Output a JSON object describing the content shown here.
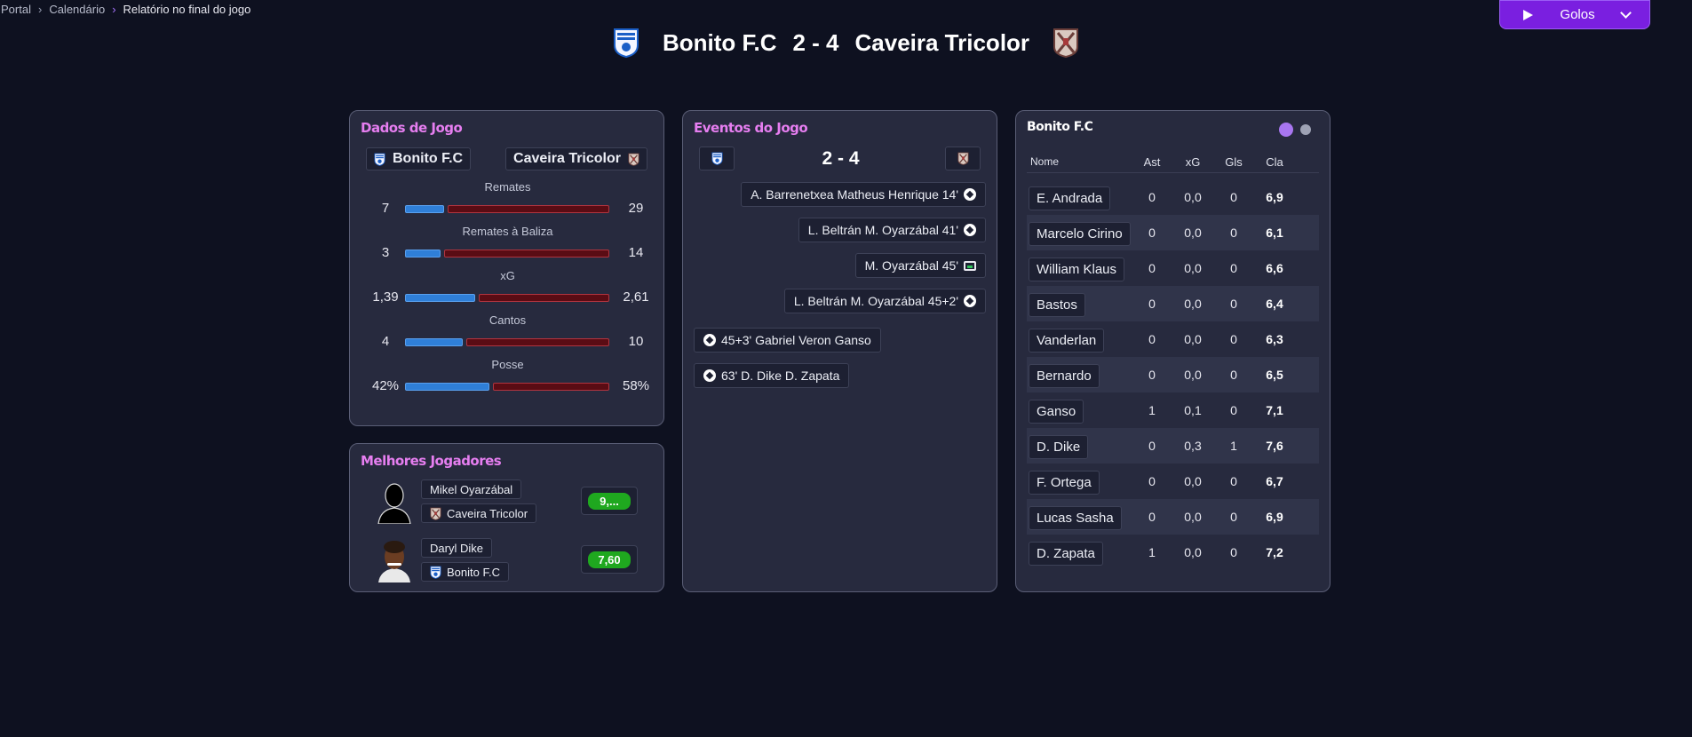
{
  "breadcrumb": [
    "Portal",
    "Calendário",
    "Relatório no final do jogo"
  ],
  "header": {
    "home_team": "Bonito F.C",
    "score": "2 - 4",
    "away_team": "Caveira Tricolor"
  },
  "play_button": {
    "label": "Golos",
    "icon": "play-icon"
  },
  "colors": {
    "accent": "#7a1fe0",
    "panel_title": "#e67ef0",
    "home_bar": "#2f7fd8",
    "away_bar": "#5a0c14",
    "rating": "#1fa81f"
  },
  "game_data": {
    "title": "Dados de Jogo",
    "home": "Bonito F.C",
    "away": "Caveira Tricolor",
    "stats": [
      {
        "label": "Remates",
        "home": "7",
        "away": "29",
        "home_frac": 0.194,
        "away_frac": 0.806
      },
      {
        "label": "Remates à Baliza",
        "home": "3",
        "away": "14",
        "home_frac": 0.176,
        "away_frac": 0.824
      },
      {
        "label": "xG",
        "home": "1,39",
        "away": "2,61",
        "home_frac": 0.348,
        "away_frac": 0.652
      },
      {
        "label": "Cantos",
        "home": "4",
        "away": "10",
        "home_frac": 0.286,
        "away_frac": 0.714
      },
      {
        "label": "Posse",
        "home": "42%",
        "away": "58%",
        "home_frac": 0.42,
        "away_frac": 0.58
      }
    ]
  },
  "best_players": {
    "title": "Melhores Jogadores",
    "players": [
      {
        "name": "Mikel Oyarzábal",
        "club": "Caveira Tricolor",
        "rating": "9,..."
      },
      {
        "name": "Daryl Dike",
        "club": "Bonito F.C",
        "rating": "7,60"
      }
    ]
  },
  "events": {
    "title": "Eventos do Jogo",
    "score": "2 - 4",
    "away": [
      {
        "text": "A. Barrenetxea  Matheus Henrique  14'",
        "icon": "ball-icon"
      },
      {
        "text": "L. Beltrán  M. Oyarzábal  41'",
        "icon": "ball-icon"
      },
      {
        "text": "M. Oyarzábal  45'",
        "icon": "var-icon"
      },
      {
        "text": "L. Beltrán  M. Oyarzábal  45+2'",
        "icon": "ball-icon"
      }
    ],
    "home": [
      {
        "text": "45+3'  Gabriel Veron  Ganso",
        "icon": "ball-icon"
      },
      {
        "text": "63'  D. Dike  D. Zapata",
        "icon": "ball-icon"
      }
    ]
  },
  "lineup": {
    "title": "Bonito F.C",
    "columns": [
      "Nome",
      "Ast",
      "xG",
      "Gls",
      "Cla"
    ],
    "rows": [
      {
        "name": "E. Andrada",
        "ast": "0",
        "xg": "0,0",
        "gls": "0",
        "cla": "6,9"
      },
      {
        "name": "Marcelo Cirino",
        "ast": "0",
        "xg": "0,0",
        "gls": "0",
        "cla": "6,1"
      },
      {
        "name": "William Klaus",
        "ast": "0",
        "xg": "0,0",
        "gls": "0",
        "cla": "6,6"
      },
      {
        "name": "Bastos",
        "ast": "0",
        "xg": "0,0",
        "gls": "0",
        "cla": "6,4"
      },
      {
        "name": "Vanderlan",
        "ast": "0",
        "xg": "0,0",
        "gls": "0",
        "cla": "6,3"
      },
      {
        "name": "Bernardo",
        "ast": "0",
        "xg": "0,0",
        "gls": "0",
        "cla": "6,5"
      },
      {
        "name": "Ganso",
        "ast": "1",
        "xg": "0,1",
        "gls": "0",
        "cla": "7,1"
      },
      {
        "name": "D. Dike",
        "ast": "0",
        "xg": "0,3",
        "gls": "1",
        "cla": "7,6"
      },
      {
        "name": "F. Ortega",
        "ast": "0",
        "xg": "0,0",
        "gls": "0",
        "cla": "6,7"
      },
      {
        "name": "Lucas Sasha",
        "ast": "0",
        "xg": "0,0",
        "gls": "0",
        "cla": "6,9"
      },
      {
        "name": "D. Zapata",
        "ast": "1",
        "xg": "0,0",
        "gls": "0",
        "cla": "7,2"
      }
    ]
  }
}
